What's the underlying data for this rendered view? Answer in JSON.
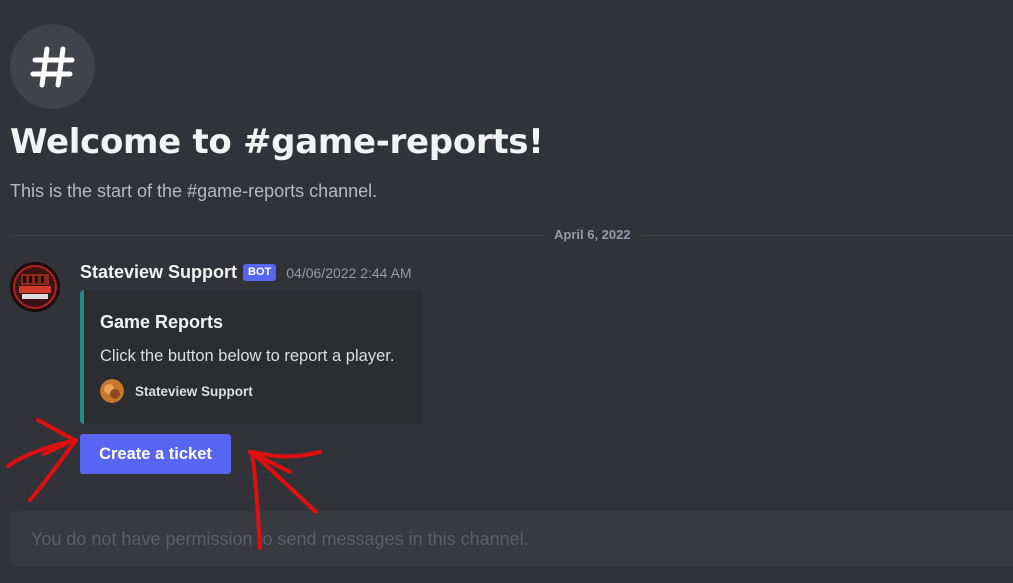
{
  "channel": {
    "icon": "hash-icon",
    "welcome_title": "Welcome to #game-reports!",
    "welcome_subtitle": "This is the start of the #game-reports channel."
  },
  "date_divider": "April 6, 2022",
  "message": {
    "author": "Stateview Support",
    "bot_tag": "BOT",
    "timestamp": "04/06/2022 2:44 AM",
    "avatar_text": "STATEVIEW PRISON",
    "embed": {
      "accent_color": "#1f8b8a",
      "title": "Game Reports",
      "description": "Click the button below to report a player.",
      "footer_text": "Stateview Support"
    },
    "button": {
      "label": "Create a ticket",
      "color": "#5865f2"
    }
  },
  "composer": {
    "placeholder": "You do not have permission to send messages in this channel."
  },
  "annotation": {
    "color": "#e01010",
    "shapes": [
      "arrow-left-pointing-at-button",
      "arrow-right-pointing-at-button"
    ]
  }
}
